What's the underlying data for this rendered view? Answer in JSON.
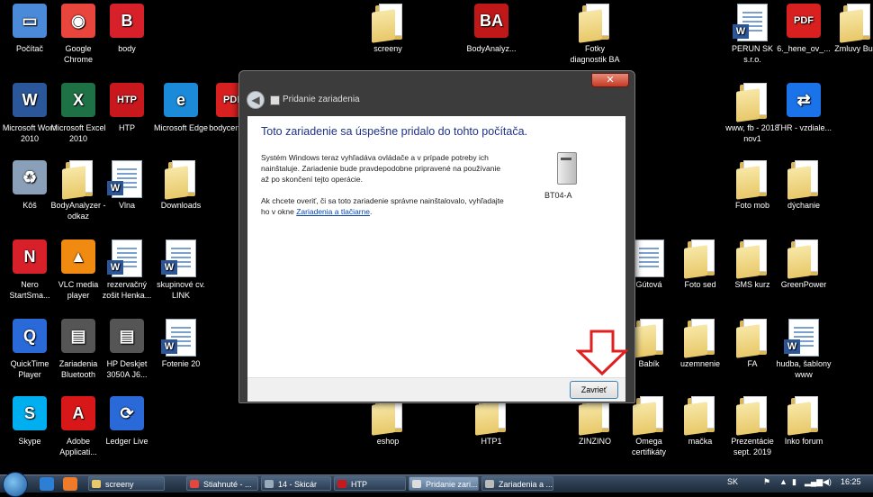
{
  "desktop": {
    "icons": [
      {
        "label": "Počítač",
        "icon": "computer-icon"
      },
      {
        "label": "Google Chrome",
        "icon": "chrome-icon"
      },
      {
        "label": "body",
        "icon": "body-centrum-icon"
      },
      {
        "label": "screeny",
        "icon": "folder-icon"
      },
      {
        "label": "BodyAnalyz...",
        "icon": "bodyanalyzer-icon"
      },
      {
        "label": "Fotky diagnostik BA",
        "icon": "folder-icon"
      },
      {
        "label": "PERUN SK s.r.o.",
        "icon": "word-doc-icon"
      },
      {
        "label": "6._hene_ov_...",
        "icon": "pdf-icon"
      },
      {
        "label": "Zmluvy Bug",
        "icon": "folder-icon"
      },
      {
        "label": "Microsoft Word 2010",
        "icon": "word-icon"
      },
      {
        "label": "Microsoft Excel 2010",
        "icon": "excel-icon"
      },
      {
        "label": "HTP",
        "icon": "htp-icon"
      },
      {
        "label": "Microsoft Edge",
        "icon": "edge-icon"
      },
      {
        "label": "bodycen logo",
        "icon": "pdf-icon"
      },
      {
        "label": "www, fb - 2018 nov1",
        "icon": "folder-icon"
      },
      {
        "label": "THR - vzdiale...",
        "icon": "teamviewer-icon"
      },
      {
        "label": "Kôš",
        "icon": "recycle-bin-icon"
      },
      {
        "label": "BodyAnalyzer - odkaz",
        "icon": "folder-icon"
      },
      {
        "label": "Vlna",
        "icon": "word-doc-icon"
      },
      {
        "label": "Downloads",
        "icon": "downloads-folder-icon"
      },
      {
        "label": "Foto mob",
        "icon": "folder-icon"
      },
      {
        "label": "dýchanie",
        "icon": "folder-icon"
      },
      {
        "label": "Nero StartSma...",
        "icon": "nero-icon"
      },
      {
        "label": "VLC media player",
        "icon": "vlc-icon"
      },
      {
        "label": "rezervačný zošit Henka...",
        "icon": "word-doc-icon"
      },
      {
        "label": "skupinové cv. LINK",
        "icon": "word-doc-icon"
      },
      {
        "label": "Gútová",
        "icon": "document-icon"
      },
      {
        "label": "Foto sed",
        "icon": "folder-icon"
      },
      {
        "label": "SMS kurz",
        "icon": "folder-icon"
      },
      {
        "label": "GreenPower",
        "icon": "folder-icon"
      },
      {
        "label": "QuickTime Player",
        "icon": "quicktime-icon"
      },
      {
        "label": "Zariadenia Bluetooth",
        "icon": "printer-icon"
      },
      {
        "label": "HP Deskjet 3050A J6...",
        "icon": "printer-icon"
      },
      {
        "label": "Fotenie 20",
        "icon": "word-doc-icon"
      },
      {
        "label": "Babík",
        "icon": "folder-icon"
      },
      {
        "label": "uzemnenie",
        "icon": "folder-icon"
      },
      {
        "label": "FA",
        "icon": "folder-icon"
      },
      {
        "label": "hudba, šablony www",
        "icon": "word-doc-icon"
      },
      {
        "label": "Skype",
        "icon": "skype-icon"
      },
      {
        "label": "Adobe Applicati...",
        "icon": "adobe-icon"
      },
      {
        "label": "Ledger Live",
        "icon": "ledger-icon"
      },
      {
        "label": "eshop",
        "icon": "folder-icon"
      },
      {
        "label": "HTP1",
        "icon": "folder-icon"
      },
      {
        "label": "ZINZINO",
        "icon": "folder-icon"
      },
      {
        "label": "Omega certifikáty",
        "icon": "folder-icon"
      },
      {
        "label": "mačka",
        "icon": "folder-icon"
      },
      {
        "label": "Prezentácie sept. 2019",
        "icon": "folder-icon"
      },
      {
        "label": "Inko forum",
        "icon": "folder-icon"
      }
    ]
  },
  "dialog": {
    "title": "Pridanie zariadenia",
    "heading": "Toto zariadenie sa úspešne pridalo do tohto počítača.",
    "paragraph1": "Systém Windows teraz vyhľadáva ovládače a v prípade potreby ich nainštaluje. Zariadenie bude pravdepodobne pripravené na používanie až po skončení tejto operácie.",
    "paragraph2_prefix": "Ak chcete overiť, či sa toto zariadenie správne nainštalovalo, vyhľadajte ho v okne ",
    "paragraph2_link": "Zariadenia a tlačiarne",
    "paragraph2_suffix": ".",
    "device_name": "BT04-A",
    "close_x": "✕",
    "close_button": "Zavrieť"
  },
  "taskbar": {
    "tasks": [
      {
        "label": "screeny",
        "icon": "folder-icon"
      },
      {
        "label": "Stiahnuté - ...",
        "icon": "chrome-icon"
      },
      {
        "label": "14 - Skicár",
        "icon": "paint-icon"
      },
      {
        "label": "HTP",
        "icon": "htp-icon"
      },
      {
        "label": "Pridanie zari...",
        "icon": "add-device-icon",
        "active": true
      },
      {
        "label": "Zariadenia a ...",
        "icon": "devices-icon"
      }
    ],
    "language": "SK",
    "time": "16:25"
  },
  "colors": {
    "heading": "#1e3287",
    "link": "#0645ad",
    "arrow": "#e02020",
    "close": "#c43b24"
  }
}
